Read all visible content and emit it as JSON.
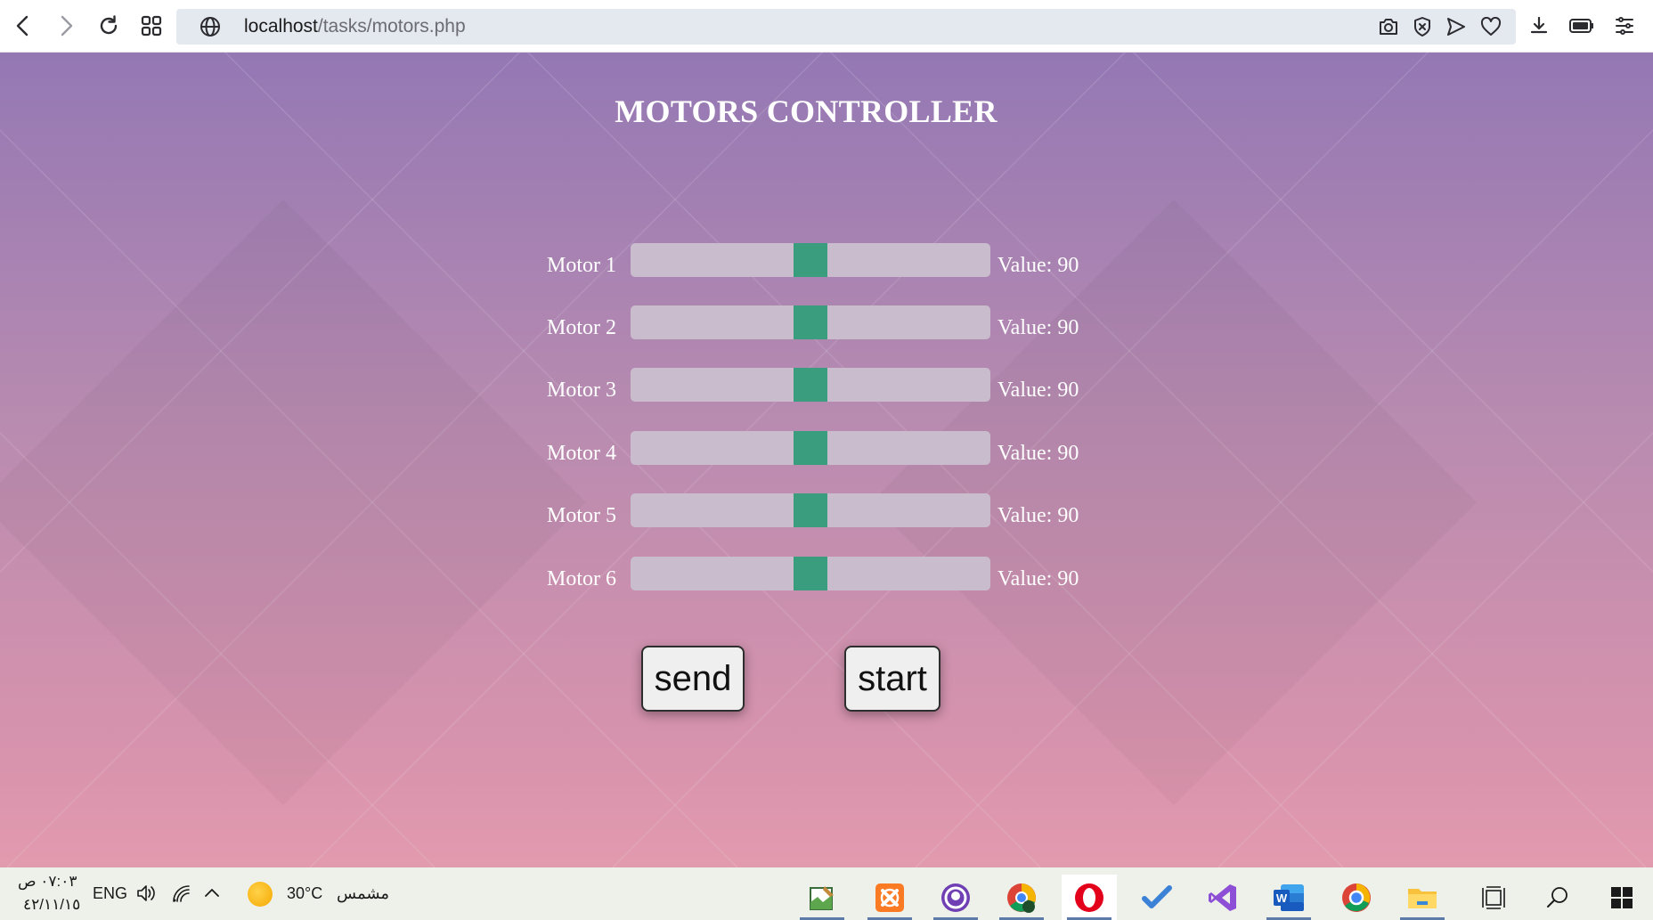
{
  "browser": {
    "url_host": "localhost",
    "url_path": "/tasks/motors.php",
    "nav_icons": [
      "back-icon",
      "forward-icon",
      "reload-icon",
      "tabs-grid-icon"
    ],
    "address_icons": [
      "camera-icon",
      "shield-icon",
      "send-icon",
      "heart-icon"
    ],
    "right_icons": [
      "download-icon",
      "battery-icon",
      "menu-icon"
    ]
  },
  "page": {
    "title": "MOTORS CONTROLLER",
    "value_prefix": "Value:",
    "motors": [
      {
        "label": "Motor 1",
        "value": 90,
        "value_text": "90",
        "min": 0,
        "max": 180
      },
      {
        "label": "Motor 2",
        "value": 90,
        "value_text": "90",
        "min": 0,
        "max": 180
      },
      {
        "label": "Motor 3",
        "value": 90,
        "value_text": "90",
        "min": 0,
        "max": 180
      },
      {
        "label": "Motor 4",
        "value": 90,
        "value_text": "90",
        "min": 0,
        "max": 180
      },
      {
        "label": "Motor 5",
        "value": 90,
        "value_text": "90",
        "min": 0,
        "max": 180
      },
      {
        "label": "Motor 6",
        "value": 90,
        "value_text": "90",
        "min": 0,
        "max": 180
      }
    ],
    "send_label": "send",
    "start_label": "start",
    "colors": {
      "slider_thumb": "#3a9d7e",
      "slider_track": "#c9bccc",
      "title": "#ffffff"
    }
  },
  "taskbar": {
    "time": "٠٧:٠٣ ص",
    "date": "٤٢/١١/١٥",
    "language": "ENG",
    "temperature": "30°C",
    "weather": "مشمس",
    "apps": [
      "notepad-icon",
      "xampp-icon",
      "github-icon",
      "chrome-profile-icon",
      "opera-icon",
      "todo-icon",
      "visual-studio-icon",
      "word-icon",
      "chrome-icon",
      "file-explorer-icon",
      "task-view-icon",
      "search-icon",
      "windows-start-icon"
    ]
  }
}
